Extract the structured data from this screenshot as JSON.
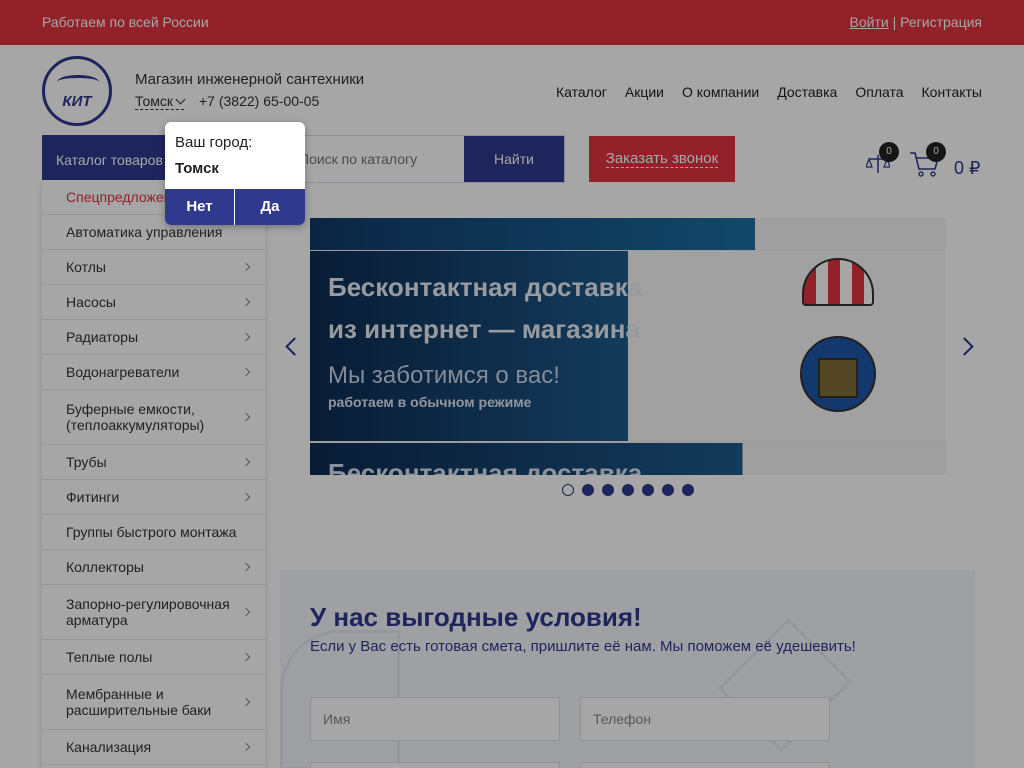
{
  "topbar": {
    "left_text": "Работаем по всей России",
    "login": "Войти",
    "separator": "|",
    "register": "Регистрация"
  },
  "header": {
    "logo_text": "КИТ",
    "shop_name": "Магазин инженерной сантехники",
    "city": "Томск",
    "phone": "+7 (3822) 65-00-05"
  },
  "nav": [
    "Каталог",
    "Акции",
    "О компании",
    "Доставка",
    "Оплата",
    "Контакты"
  ],
  "search": {
    "catalog_button": "Каталог товаров",
    "placeholder": "Поиск по каталогу",
    "button": "Найти"
  },
  "callback_button": "Заказать звонок",
  "cart": {
    "compare_count": "0",
    "cart_count": "0",
    "sum": "0 ₽"
  },
  "sidebar": [
    {
      "label": "Спецпредложения",
      "red": true,
      "arrow": false
    },
    {
      "label": "Автоматика управления",
      "arrow": false
    },
    {
      "label": "Котлы",
      "arrow": true
    },
    {
      "label": "Насосы",
      "arrow": true
    },
    {
      "label": "Радиаторы",
      "arrow": true
    },
    {
      "label": "Водонагреватели",
      "arrow": true
    },
    {
      "label": "Буферные емкости, (теплоаккумуляторы)",
      "arrow": true
    },
    {
      "label": "Трубы",
      "arrow": true
    },
    {
      "label": "Фитинги",
      "arrow": true
    },
    {
      "label": "Группы быстрого монтажа",
      "arrow": false
    },
    {
      "label": "Коллекторы",
      "arrow": true
    },
    {
      "label": "Запорно-регулировочная арматура",
      "arrow": true
    },
    {
      "label": "Теплые полы",
      "arrow": true
    },
    {
      "label": "Мембранные и расширительные баки",
      "arrow": true
    },
    {
      "label": "Канализация",
      "arrow": true
    }
  ],
  "slider": {
    "title_line1": "Бесконтактная доставка",
    "title_line2": "из интернет — магазина",
    "subtitle": "Мы заботимся о вас!",
    "subtitle2": "работаем в обычном режиме",
    "ghost": "Бесконтактная доставка",
    "dots_total": 7,
    "active_dot": 0
  },
  "conditions": {
    "title": "У нас выгодные условия!",
    "text": "Если у Вас есть готовая смета, пришлите её нам. Мы поможем её удешевить!",
    "name_placeholder": "Имя",
    "phone_placeholder": "Телефон"
  },
  "city_popup": {
    "question": "Ваш город:",
    "city": "Томск",
    "no": "Нет",
    "yes": "Да"
  },
  "colors": {
    "brand_red": "#e0343f",
    "brand_blue": "#2f3a8f"
  }
}
